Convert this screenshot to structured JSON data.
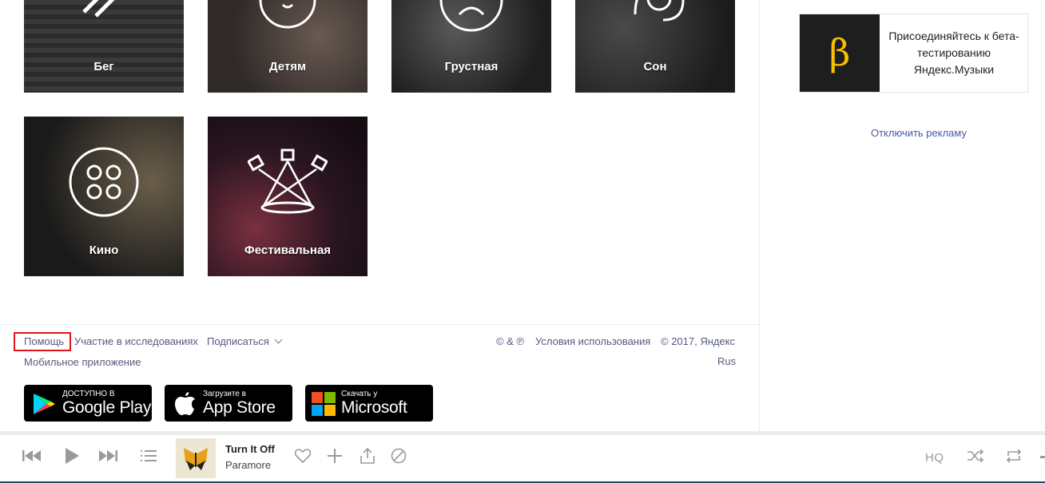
{
  "tiles": [
    {
      "label": "Бег"
    },
    {
      "label": "Детям"
    },
    {
      "label": "Грустная"
    },
    {
      "label": "Сон"
    },
    {
      "label": "Кино"
    },
    {
      "label": "Фестивальная"
    }
  ],
  "footer": {
    "help": "Помощь",
    "research": "Участие в исследованиях",
    "subscribe": "Подписаться",
    "mobile_app": "Мобильное приложение",
    "copyright_sign": "© & ℗",
    "terms": "Условия использования",
    "copyright": "© 2017, Яндекс",
    "lang": "Rus"
  },
  "stores": {
    "google_small": "ДОСТУПНО В",
    "google_big": "Google Play",
    "apple_small": "Загрузите в",
    "apple_big": "App Store",
    "ms_small": "Скачать у",
    "ms_big": "Microsoft"
  },
  "sidebar": {
    "beta_symbol": "β",
    "beta_text": "Присоединяйтесь к бета-тестированию Яндекс.Музыки",
    "ads_off": "Отключить рекламу"
  },
  "player": {
    "track": "Turn It Off",
    "artist": "Paramore",
    "hq": "HQ"
  },
  "colors": {
    "link": "#4a57a8",
    "highlight": "#e0141e",
    "beta_accent": "#f5c000"
  }
}
